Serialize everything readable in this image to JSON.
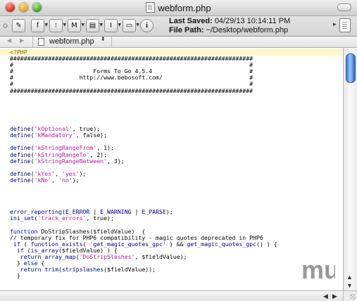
{
  "window": {
    "title": "webform.php",
    "title_icon": "php-document-icon"
  },
  "toolbar": {
    "buttons": [
      {
        "name": "edit-pencil",
        "glyph": "✎"
      },
      {
        "name": "function-menu",
        "glyph": "f"
      },
      {
        "name": "markers-menu",
        "glyph": "⁝"
      },
      {
        "name": "macro-menu",
        "glyph": "M"
      },
      {
        "name": "document-menu",
        "glyph": "▤"
      },
      {
        "name": "text-menu",
        "glyph": "I"
      },
      {
        "name": "window-menu",
        "glyph": "▭"
      },
      {
        "name": "info",
        "glyph": "i"
      }
    ],
    "last_saved_label": "Last Saved:",
    "last_saved_value": "04/29/13 10:14:11 PM",
    "file_path_label": "File Path:",
    "file_path_value": "~/Desktop/webform.php"
  },
  "navbar": {
    "back_glyph": "◀",
    "forward_glyph": "▶",
    "filename": "webform.php",
    "updown_glyph": "⬍"
  },
  "code_lines": [
    "<?PHP",
    "######################################################################",
    "#                                                                    #",
    "#                       Forms To Go 4.5.4                            #",
    "#                   http://www.bebosoft.com/                         #",
    "#                                                                    #",
    "######################################################################",
    "",
    "",
    "",
    "",
    "",
    "define('kOptional', true);",
    "define('kMandatory', false);",
    "",
    "define('kStringRangeFrom', 1);",
    "define('kStringRangeTo', 2);",
    "define('kStringRangeBetween', 3);",
    "",
    "define('kYes', 'yes');",
    "define('kNo', 'no');",
    "",
    "",
    "",
    "",
    "error_reporting(E_ERROR | E_WARNING | E_PARSE);",
    "ini_set('track_errors', true);",
    "",
    "function DoStripSlashes($fieldValue)  {",
    "// temporary fix for PHP6 compatibility - magic quotes deprecated in PHP6",
    " if ( function_exists( 'get_magic_quotes_gpc' ) && get_magic_quotes_gpc() ) {",
    "  if (is_array($fieldValue) ) {",
    "   return array_map('DoStripSlashes', $fieldValue);",
    "  } else {",
    "   return trim(stripslashes($fieldValue));",
    "  }"
  ],
  "colors": {
    "function": "#000080",
    "string": "#b5179e",
    "highlight": "#fbf7c9"
  },
  "watermark": "mu"
}
